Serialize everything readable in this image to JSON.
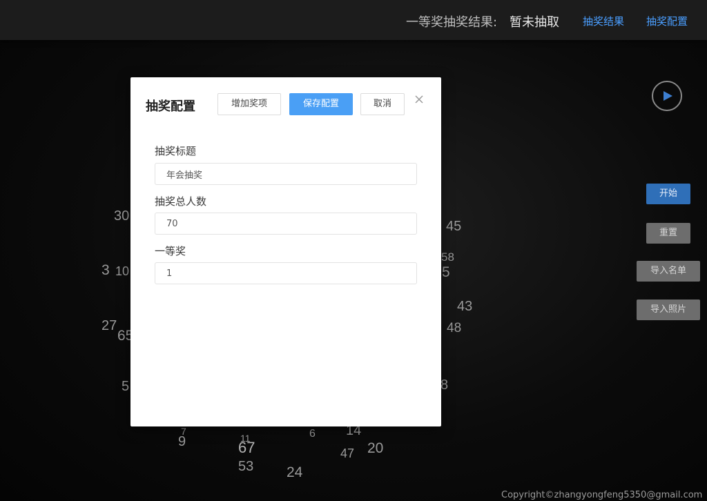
{
  "header": {
    "result_label": "一等奖抽奖结果:",
    "result_value": "暂未抽取",
    "nav_results": "抽奖结果",
    "nav_config": "抽奖配置"
  },
  "side_buttons": {
    "start": "开始",
    "reset": "重置",
    "import_list": "导入名单",
    "import_photo": "导入照片"
  },
  "balls": [
    "30",
    "45",
    "58",
    "3",
    "10",
    "5",
    "43",
    "27",
    "65",
    "48",
    "5",
    "8",
    "7",
    "9",
    "11",
    "6",
    "14",
    "67",
    "47",
    "20",
    "53",
    "24"
  ],
  "modal": {
    "title": "抽奖配置",
    "add_prize": "增加奖项",
    "save": "保存配置",
    "cancel": "取消",
    "fields": [
      {
        "label": "抽奖标题",
        "value": "年会抽奖"
      },
      {
        "label": "抽奖总人数",
        "value": "70"
      },
      {
        "label": "一等奖",
        "value": "1"
      }
    ]
  },
  "footer": {
    "copyright": "Copyright©zhangyongfeng5350@gmail.com"
  }
}
